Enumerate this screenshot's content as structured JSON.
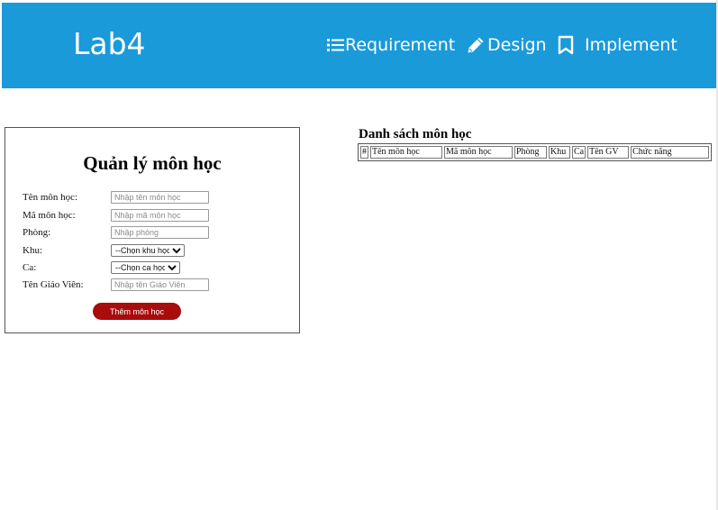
{
  "header": {
    "logo": "Lab4",
    "nav": [
      {
        "label": "Requirement",
        "icon": "list-icon"
      },
      {
        "label": "Design",
        "icon": "pencil-icon"
      },
      {
        "label": "Implement",
        "icon": "bookmark-icon"
      }
    ],
    "background_color": "#1a9ad9"
  },
  "form": {
    "title": "Quản lý môn học",
    "fields": [
      {
        "label": "Tên môn học:",
        "placeholder": "Nhập tên môn học",
        "value": ""
      },
      {
        "label": "Mã môn học:",
        "placeholder": "Nhập mã môn học",
        "value": ""
      },
      {
        "label": "Phòng:",
        "placeholder": "Nhập phòng",
        "value": ""
      },
      {
        "label": "Khu:",
        "selected": "--Chọn khu học--"
      },
      {
        "label": "Ca:",
        "selected": "--Chọn ca học--"
      },
      {
        "label": "Tên Giáo Viên:",
        "placeholder": "Nhập tên Giáo Viên",
        "value": ""
      }
    ],
    "submit_label": "Thêm môn học",
    "submit_color": "#a80c0c"
  },
  "list": {
    "title": "Danh sách môn học",
    "columns": [
      "#",
      "Tên môn học",
      "Mã môn học",
      "Phòng",
      "Khu",
      "Ca",
      "Tên GV",
      "Chức năng"
    ]
  }
}
